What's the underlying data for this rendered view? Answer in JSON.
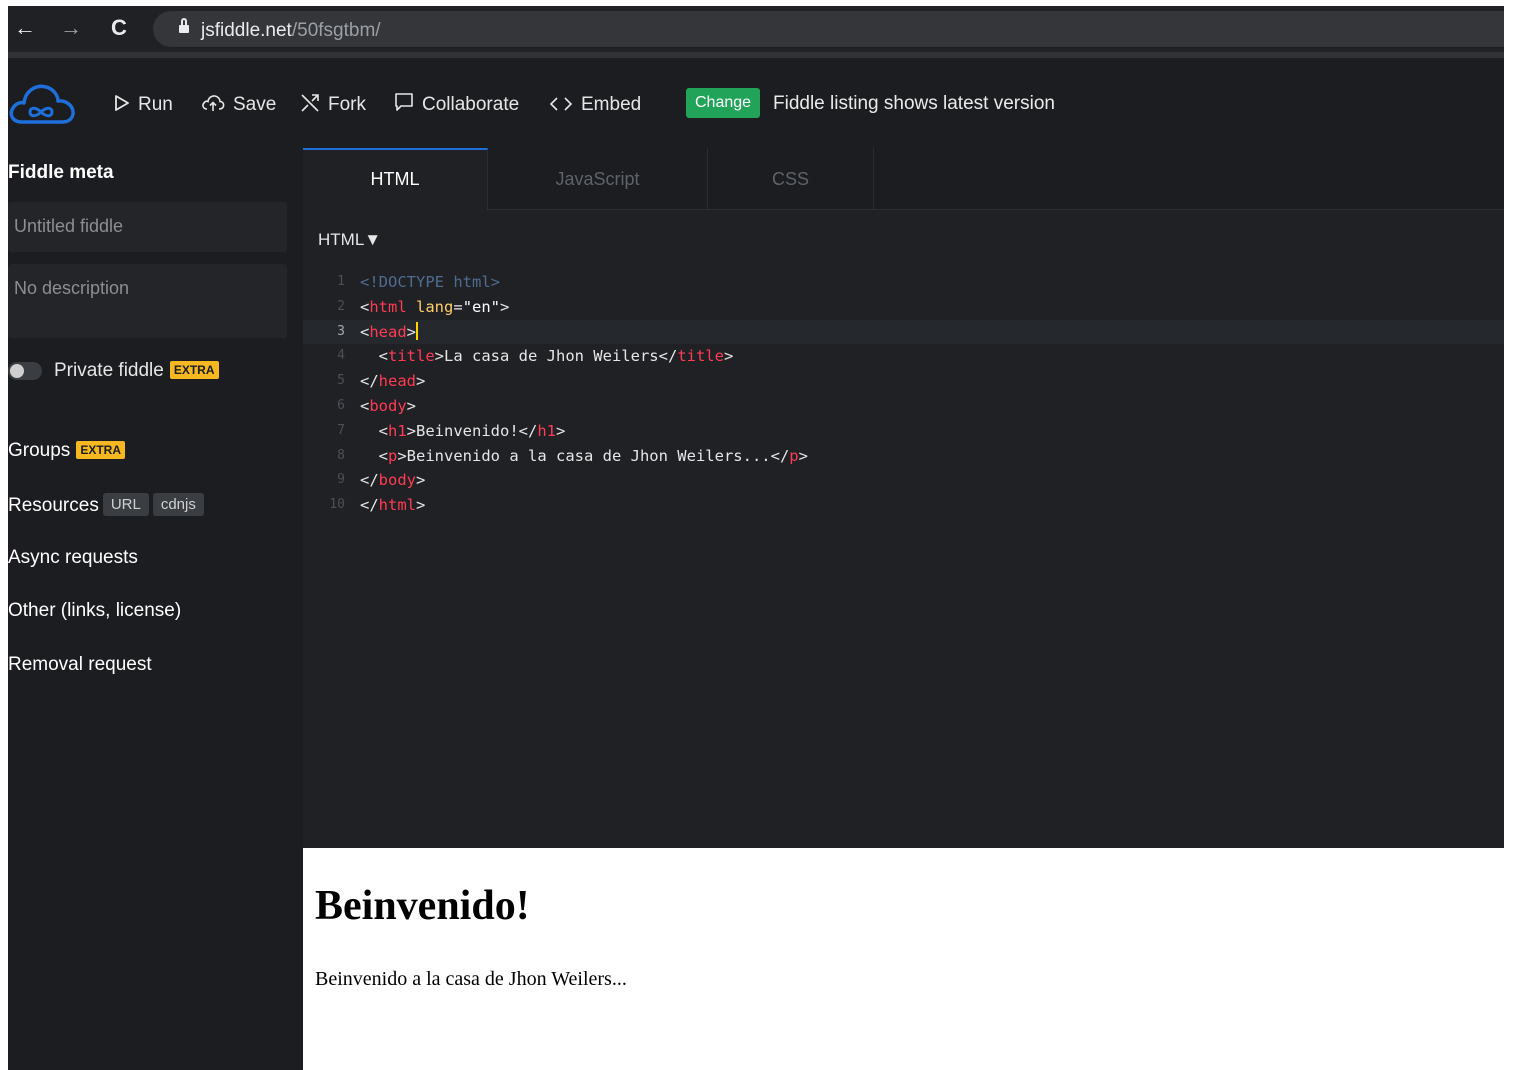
{
  "browser": {
    "back_icon": "←",
    "forward_icon": "→",
    "reload_icon": "C",
    "url_host": "jsfiddle.net",
    "url_path": "/50fsgtbm/"
  },
  "toolbar": {
    "run_label": "Run",
    "save_label": "Save",
    "fork_label": "Fork",
    "collaborate_label": "Collaborate",
    "embed_label": "Embed",
    "change_label": "Change",
    "listing_text": "Fiddle listing shows latest version",
    "accent_color": "#22a35a"
  },
  "sidebar": {
    "title": "Fiddle meta",
    "title_placeholder": "Untitled fiddle",
    "description_placeholder": "No description",
    "private_label": "Private fiddle",
    "extra_badge": "EXTRA",
    "private_enabled": false,
    "groups_label": "Groups",
    "resources_label": "Resources",
    "resources_chips": [
      "URL",
      "cdnjs"
    ],
    "async_label": "Async requests",
    "other_label": "Other (links, license)",
    "removal_label": "Removal request"
  },
  "editor": {
    "tabs": [
      "HTML",
      "JavaScript",
      "CSS"
    ],
    "active_tab": "HTML",
    "language_select": "HTML▼",
    "current_line": 3,
    "lines": [
      {
        "n": "1",
        "tokens": [
          {
            "c": "t-doc",
            "t": "<!DOCTYPE html>"
          }
        ]
      },
      {
        "n": "2",
        "tokens": [
          {
            "c": "t-txt",
            "t": "<"
          },
          {
            "c": "t-tag",
            "t": "html"
          },
          {
            "c": "t-txt",
            "t": " "
          },
          {
            "c": "t-attr",
            "t": "lang"
          },
          {
            "c": "t-txt",
            "t": "="
          },
          {
            "c": "t-str",
            "t": "\"en\""
          },
          {
            "c": "t-txt",
            "t": ">"
          }
        ]
      },
      {
        "n": "3",
        "tokens": [
          {
            "c": "t-txt",
            "t": "<"
          },
          {
            "c": "t-tag",
            "t": "head"
          },
          {
            "c": "t-txt",
            "t": ">"
          }
        ]
      },
      {
        "n": "4",
        "tokens": [
          {
            "c": "t-txt",
            "t": "  <"
          },
          {
            "c": "t-tag",
            "t": "title"
          },
          {
            "c": "t-txt",
            "t": ">La casa de Jhon Weilers</"
          },
          {
            "c": "t-tag",
            "t": "title"
          },
          {
            "c": "t-txt",
            "t": ">"
          }
        ]
      },
      {
        "n": "5",
        "tokens": [
          {
            "c": "t-txt",
            "t": "</"
          },
          {
            "c": "t-tag",
            "t": "head"
          },
          {
            "c": "t-txt",
            "t": ">"
          }
        ]
      },
      {
        "n": "6",
        "tokens": [
          {
            "c": "t-txt",
            "t": "<"
          },
          {
            "c": "t-tag",
            "t": "body"
          },
          {
            "c": "t-txt",
            "t": ">"
          }
        ]
      },
      {
        "n": "7",
        "tokens": [
          {
            "c": "t-txt",
            "t": "  <"
          },
          {
            "c": "t-tag",
            "t": "h1"
          },
          {
            "c": "t-txt",
            "t": ">Beinvenido!</"
          },
          {
            "c": "t-tag",
            "t": "h1"
          },
          {
            "c": "t-txt",
            "t": ">"
          }
        ]
      },
      {
        "n": "8",
        "tokens": [
          {
            "c": "t-txt",
            "t": "  <"
          },
          {
            "c": "t-tag",
            "t": "p"
          },
          {
            "c": "t-txt",
            "t": ">Beinvenido a la casa de Jhon Weilers...</"
          },
          {
            "c": "t-tag",
            "t": "p"
          },
          {
            "c": "t-txt",
            "t": ">"
          }
        ]
      },
      {
        "n": "9",
        "tokens": [
          {
            "c": "t-txt",
            "t": "</"
          },
          {
            "c": "t-tag",
            "t": "body"
          },
          {
            "c": "t-txt",
            "t": ">"
          }
        ]
      },
      {
        "n": "10",
        "tokens": [
          {
            "c": "t-txt",
            "t": "</"
          },
          {
            "c": "t-tag",
            "t": "html"
          },
          {
            "c": "t-txt",
            "t": ">"
          }
        ]
      }
    ]
  },
  "preview": {
    "heading": "Beinvenido!",
    "paragraph": "Beinvenido a la casa de Jhon Weilers..."
  }
}
